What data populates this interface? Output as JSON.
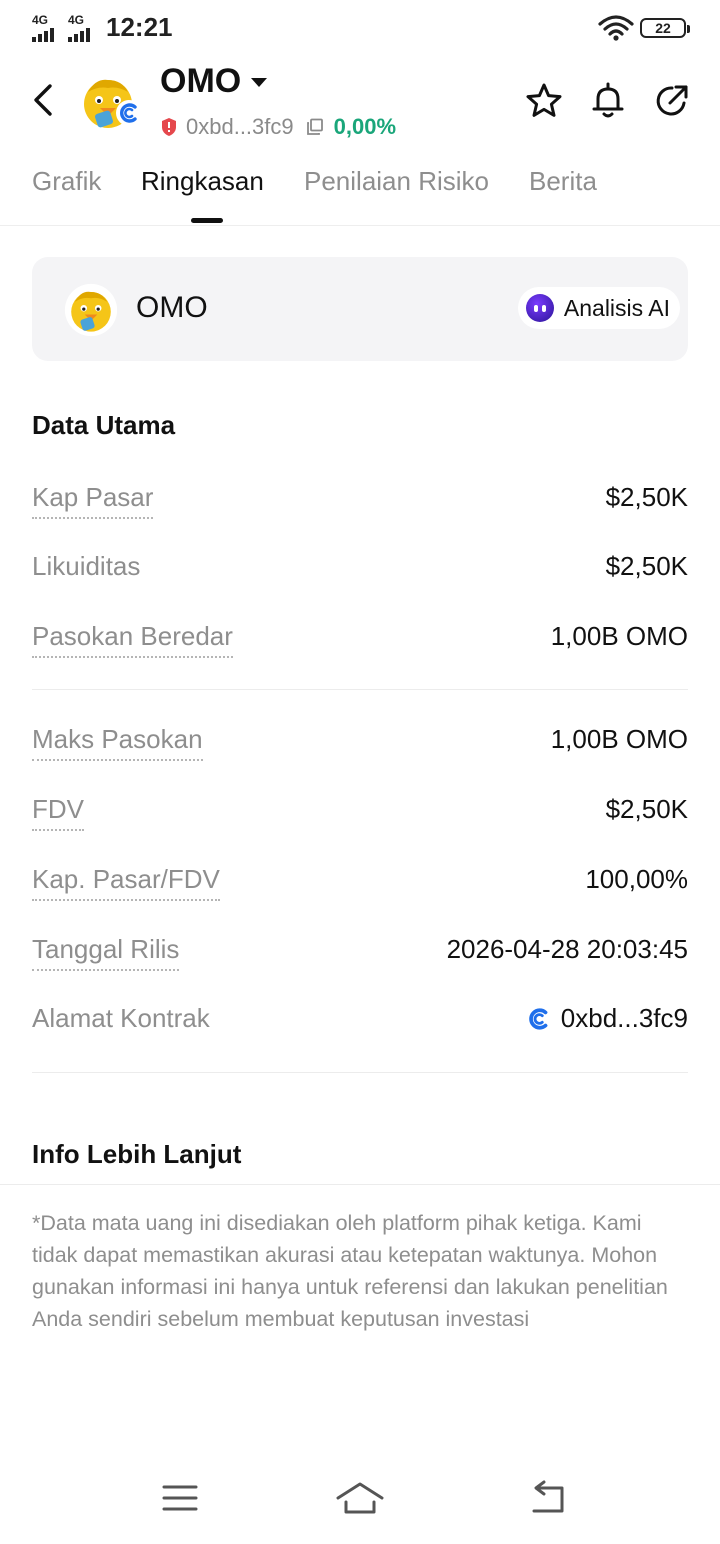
{
  "status_bar": {
    "net1": "4G",
    "net2": "4G",
    "time": "12:21",
    "battery": "22"
  },
  "header": {
    "title": "OMO",
    "address": "0xbd...3fc9",
    "change": "0,00%",
    "change_color": "#1aa67a",
    "icons": [
      "back-icon",
      "star-icon",
      "bell-icon",
      "share-icon"
    ]
  },
  "tabs": [
    {
      "label": "Grafik",
      "active": false
    },
    {
      "label": "Ringkasan",
      "active": true
    },
    {
      "label": "Penilaian Risiko",
      "active": false
    },
    {
      "label": "Berita",
      "active": false
    }
  ],
  "card": {
    "name": "OMO",
    "ai_label": "Analisis AI"
  },
  "key_data": {
    "title": "Data Utama",
    "rows": [
      {
        "label": "Kap Pasar",
        "value": "$2,50K"
      },
      {
        "label": "Likuiditas",
        "value": "$2,50K"
      },
      {
        "label": "Pasokan Beredar",
        "value": "1,00B OMO"
      },
      {
        "label": "Maks Pasokan",
        "value": "1,00B OMO"
      },
      {
        "label": "FDV",
        "value": "$2,50K"
      },
      {
        "label": "Kap. Pasar/FDV",
        "value": "100,00%"
      },
      {
        "label": "Tanggal Rilis",
        "value": "2026-04-28 20:03:45"
      },
      {
        "label": "Alamat Kontrak",
        "value": "0xbd...3fc9"
      }
    ]
  },
  "more_info": {
    "title": "Info Lebih Lanjut",
    "disclaimer": "*Data mata uang ini disediakan oleh platform pihak ketiga. Kami tidak dapat memastikan akurasi atau ketepatan waktunya. Mohon gunakan informasi ini hanya untuk referensi dan lakukan penelitian Anda sendiri sebelum membuat keputusan investasi"
  },
  "colors": {
    "accent_green": "#1aa67a",
    "risk_red": "#e5484d",
    "chain_blue": "#1f6feb",
    "ai_purple": "#5a22d9"
  }
}
